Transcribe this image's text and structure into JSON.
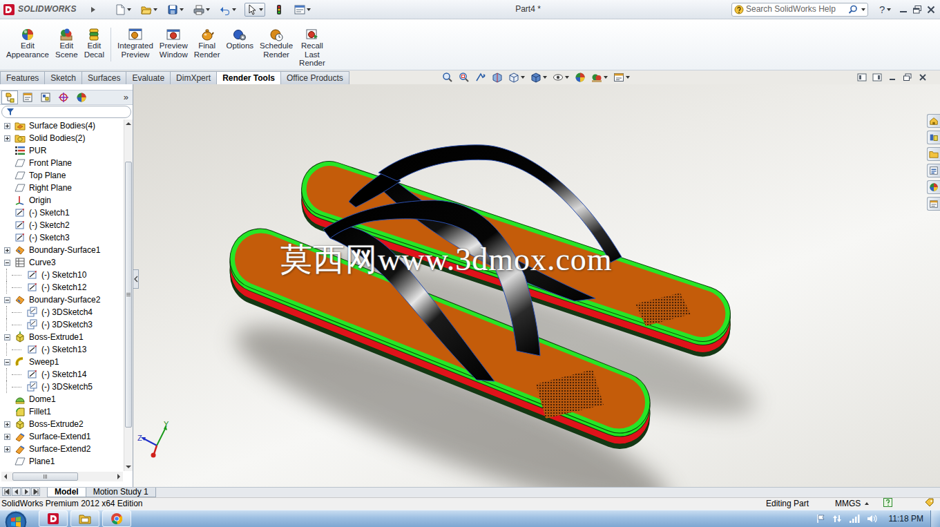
{
  "app": {
    "logo": "SOLIDWORKS"
  },
  "window": {
    "title": "Part4 *"
  },
  "search": {
    "placeholder": "Search SolidWorks Help"
  },
  "help": {
    "label": "?"
  },
  "ribbon": [
    {
      "lines": [
        "Edit",
        "Appearance"
      ]
    },
    {
      "lines": [
        "Edit",
        "Scene"
      ]
    },
    {
      "lines": [
        "Edit",
        "Decal"
      ]
    },
    {
      "lines": [
        "Integrated",
        "Preview"
      ]
    },
    {
      "lines": [
        "Preview",
        "Window"
      ]
    },
    {
      "lines": [
        "Final",
        "Render"
      ]
    },
    {
      "lines": [
        "Options"
      ]
    },
    {
      "lines": [
        "Schedule",
        "Render"
      ]
    },
    {
      "lines": [
        "Recall",
        "Last",
        "Render"
      ]
    }
  ],
  "tabs": [
    {
      "label": "Features",
      "selected": false
    },
    {
      "label": "Sketch",
      "selected": false
    },
    {
      "label": "Surfaces",
      "selected": false
    },
    {
      "label": "Evaluate",
      "selected": false
    },
    {
      "label": "DimXpert",
      "selected": false
    },
    {
      "label": "Render Tools",
      "selected": true
    },
    {
      "label": "Office Products",
      "selected": false
    }
  ],
  "panel": {
    "more": "»"
  },
  "tree": [
    {
      "label": "Surface Bodies(4)",
      "level": 0,
      "kind": "surface-folder",
      "expandable": true,
      "expanded": false
    },
    {
      "label": "Solid Bodies(2)",
      "level": 0,
      "kind": "solid-folder",
      "expandable": true,
      "expanded": false
    },
    {
      "label": "PUR",
      "level": 0,
      "kind": "material",
      "expandable": false,
      "expanded": false
    },
    {
      "label": "Front Plane",
      "level": 0,
      "kind": "plane",
      "expandable": false,
      "expanded": false
    },
    {
      "label": "Top Plane",
      "level": 0,
      "kind": "plane",
      "expandable": false,
      "expanded": false
    },
    {
      "label": "Right Plane",
      "level": 0,
      "kind": "plane",
      "expandable": false,
      "expanded": false
    },
    {
      "label": "Origin",
      "level": 0,
      "kind": "origin",
      "expandable": false,
      "expanded": false
    },
    {
      "label": "(-) Sketch1",
      "level": 0,
      "kind": "sketch",
      "expandable": false,
      "expanded": false
    },
    {
      "label": "(-) Sketch2",
      "level": 0,
      "kind": "sketch",
      "expandable": false,
      "expanded": false
    },
    {
      "label": "(-) Sketch3",
      "level": 0,
      "kind": "sketch",
      "expandable": false,
      "expanded": false
    },
    {
      "label": "Boundary-Surface1",
      "level": 0,
      "kind": "surface",
      "expandable": true,
      "expanded": false
    },
    {
      "label": "Curve3",
      "level": 0,
      "kind": "curve",
      "expandable": true,
      "expanded": true
    },
    {
      "label": "(-) Sketch10",
      "level": 1,
      "kind": "sketch",
      "expandable": false,
      "expanded": false
    },
    {
      "label": "(-) Sketch12",
      "level": 1,
      "kind": "sketch",
      "expandable": false,
      "expanded": false
    },
    {
      "label": "Boundary-Surface2",
      "level": 0,
      "kind": "surface",
      "expandable": true,
      "expanded": true
    },
    {
      "label": "(-) 3DSketch4",
      "level": 1,
      "kind": "sketch3d",
      "expandable": false,
      "expanded": false
    },
    {
      "label": "(-) 3DSketch3",
      "level": 1,
      "kind": "sketch3d",
      "expandable": false,
      "expanded": false
    },
    {
      "label": "Boss-Extrude1",
      "level": 0,
      "kind": "extrude",
      "expandable": true,
      "expanded": true
    },
    {
      "label": "(-) Sketch13",
      "level": 1,
      "kind": "sketch",
      "expandable": false,
      "expanded": false
    },
    {
      "label": "Sweep1",
      "level": 0,
      "kind": "sweep",
      "expandable": true,
      "expanded": true
    },
    {
      "label": "(-) Sketch14",
      "level": 1,
      "kind": "sketch",
      "expandable": false,
      "expanded": false
    },
    {
      "label": "(-) 3DSketch5",
      "level": 1,
      "kind": "sketch3d",
      "expandable": false,
      "expanded": false
    },
    {
      "label": "Dome1",
      "level": 0,
      "kind": "dome",
      "expandable": false,
      "expanded": false
    },
    {
      "label": "Fillet1",
      "level": 0,
      "kind": "fillet",
      "expandable": false,
      "expanded": false
    },
    {
      "label": "Boss-Extrude2",
      "level": 0,
      "kind": "extrude",
      "expandable": true,
      "expanded": false
    },
    {
      "label": "Surface-Extend1",
      "level": 0,
      "kind": "surface-extend",
      "expandable": true,
      "expanded": false
    },
    {
      "label": "Surface-Extend2",
      "level": 0,
      "kind": "surface-extend",
      "expandable": true,
      "expanded": false
    },
    {
      "label": "Plane1",
      "level": 0,
      "kind": "plane",
      "expandable": false,
      "expanded": false
    }
  ],
  "watermark": "莫西网www.3dmox.com",
  "triad": {
    "y": "Y",
    "z": "Z"
  },
  "model_tabs": [
    {
      "label": "Model",
      "selected": true
    },
    {
      "label": "Motion Study 1",
      "selected": false
    }
  ],
  "status_bar": {
    "product": "SolidWorks Premium 2012 x64 Edition",
    "mode": "Editing Part",
    "units": "MMGS"
  },
  "taskbar": {
    "time": "11:18 PM"
  }
}
